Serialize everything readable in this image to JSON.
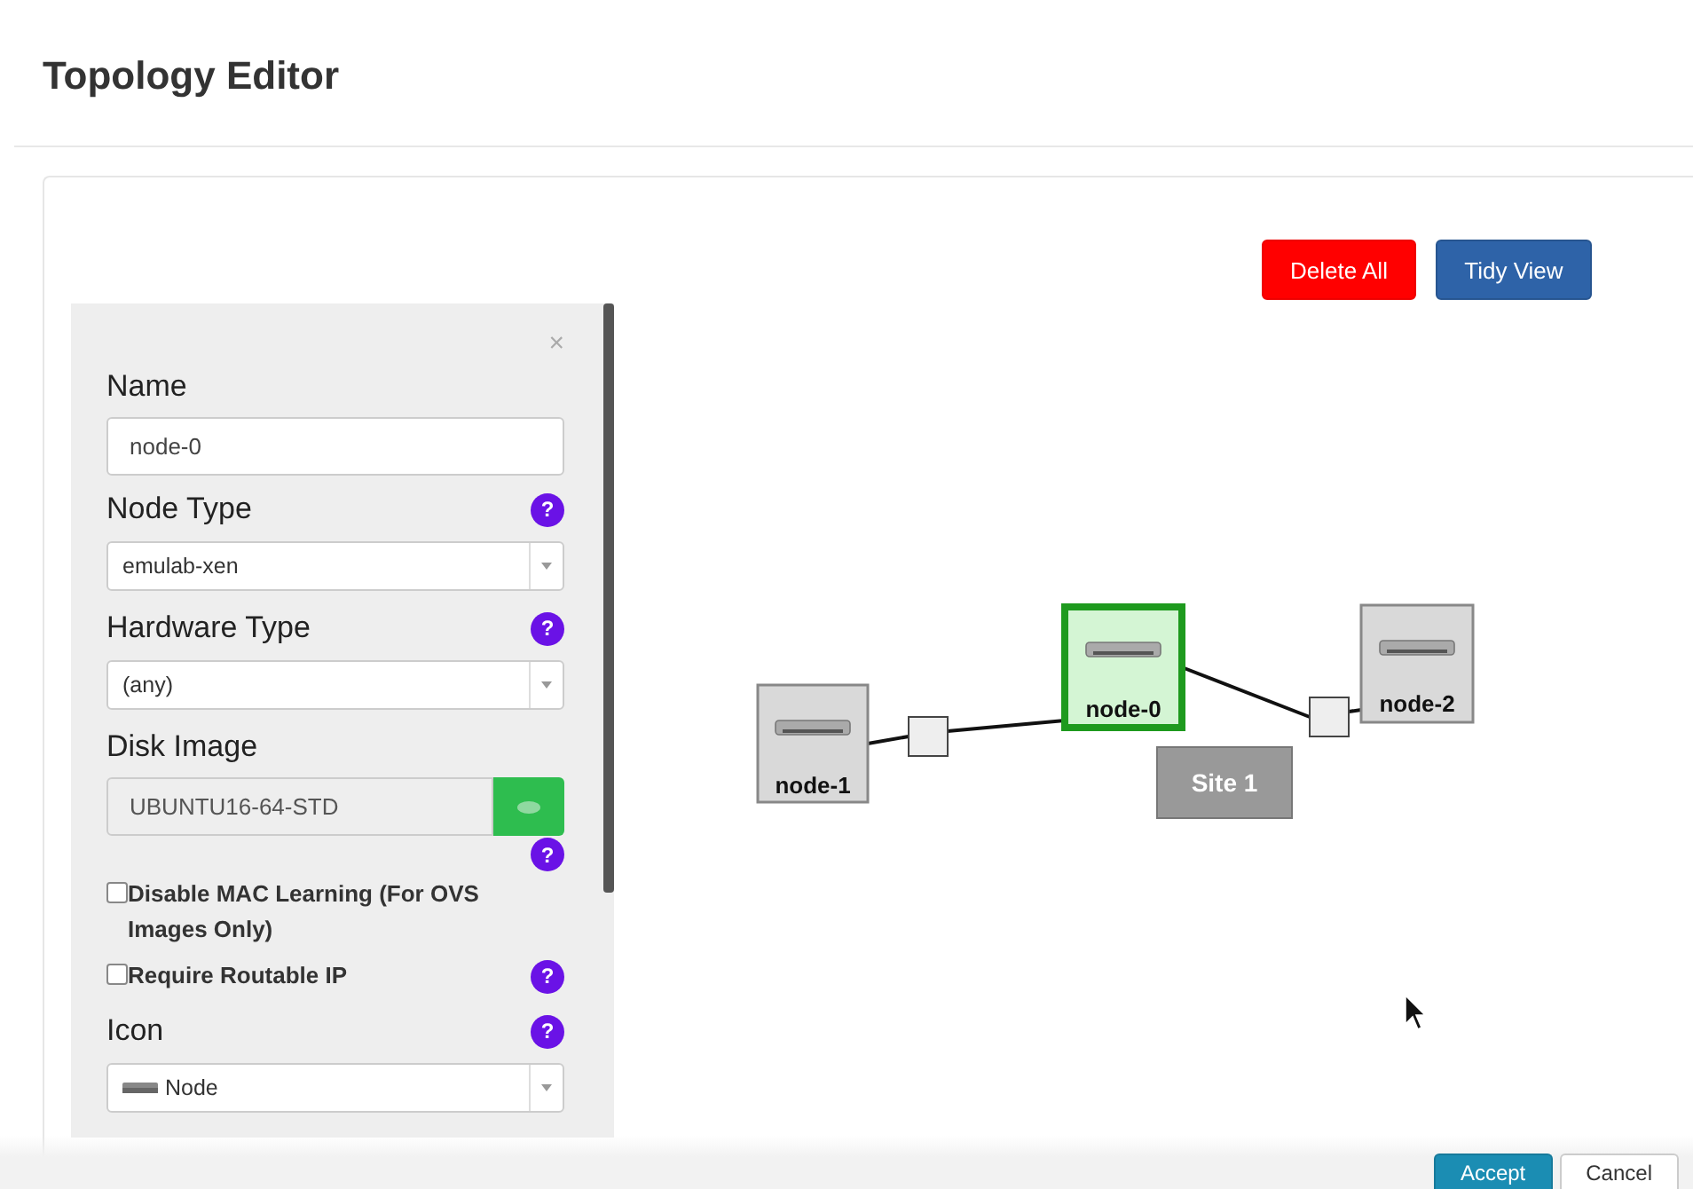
{
  "window": {
    "title": "Topology Editor"
  },
  "toolbar": {
    "buttons": [
      {
        "label": "Delete All",
        "kind": "danger"
      },
      {
        "label": "Tidy View",
        "kind": "primary"
      }
    ]
  },
  "panel": {
    "close": "×",
    "fields": [
      {
        "kind": "text",
        "label": "Name",
        "value": "node-0"
      },
      {
        "kind": "select",
        "label": "Node Type",
        "value": "emulab-xen",
        "help": "?"
      },
      {
        "kind": "select",
        "label": "Hardware Type",
        "value": "(any)",
        "help": "?"
      },
      {
        "kind": "image",
        "label": "Disk Image",
        "value": "UBUNTU16-64-STD",
        "help": "?"
      },
      {
        "kind": "checkbox",
        "label": "Disable MAC Learning (For OVS Images Only)",
        "checked": false
      },
      {
        "kind": "checkbox",
        "label": "Require Routable IP",
        "checked": false,
        "help": "?"
      },
      {
        "kind": "iconselect",
        "label": "Icon",
        "value": "Node",
        "help": "?"
      }
    ]
  },
  "canvas": {
    "nodes": [
      {
        "label": "node-0",
        "selected": true
      },
      {
        "label": "node-1",
        "selected": false
      },
      {
        "label": "node-2",
        "selected": false
      }
    ],
    "site": {
      "label": "Site 1"
    }
  },
  "footer": {
    "buttons": [
      {
        "label": "Accept",
        "kind": "primary"
      },
      {
        "label": "Cancel",
        "kind": "default"
      }
    ]
  }
}
